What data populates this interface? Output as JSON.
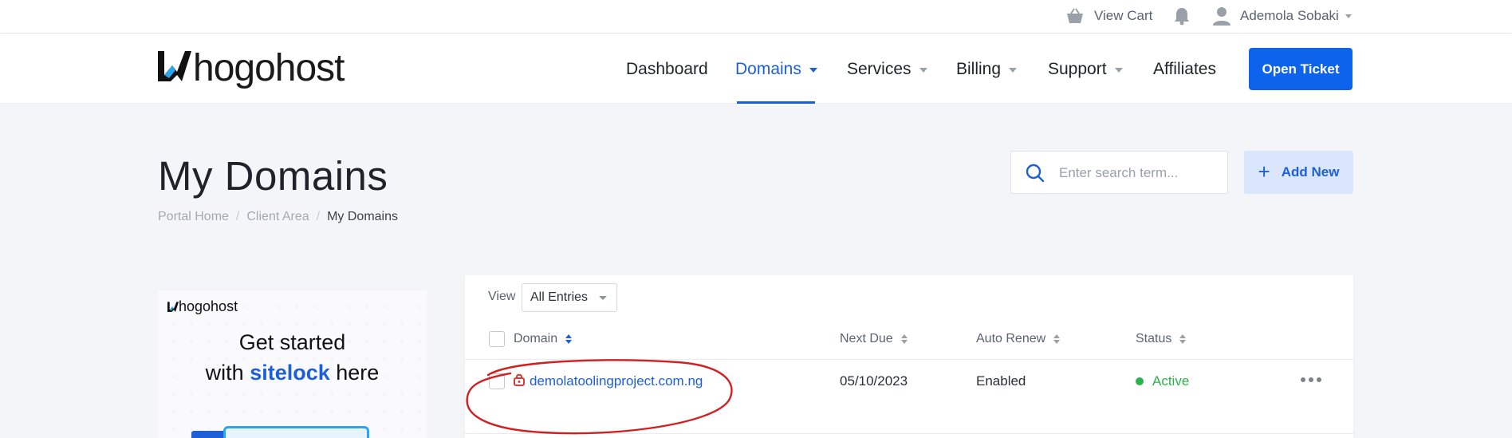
{
  "topbar": {
    "cart_label": "View Cart",
    "user_name": "Ademola Sobaki"
  },
  "nav": {
    "brand": "hogohost",
    "items": [
      {
        "label": "Dashboard"
      },
      {
        "label": "Domains"
      },
      {
        "label": "Services"
      },
      {
        "label": "Billing"
      },
      {
        "label": "Support"
      },
      {
        "label": "Affiliates"
      }
    ],
    "active_item": "Domains",
    "cta_label": "Open Ticket"
  },
  "page": {
    "title": "My Domains",
    "breadcrumb": [
      "Portal Home",
      "Client Area",
      "My Domains"
    ],
    "search_placeholder": "Enter search term...",
    "add_label": "Add New"
  },
  "banner": {
    "brand": "hogohost",
    "line1": "Get started",
    "line2_pre": "with ",
    "line2_highlight": "sitelock",
    "line2_post": " here"
  },
  "table": {
    "view_label": "View",
    "view_value": "All Entries",
    "columns": [
      "Domain",
      "Next Due",
      "Auto Renew",
      "Status"
    ],
    "rows": [
      {
        "domain": "demolatoolingproject.com.ng",
        "next_due": "05/10/2023",
        "auto_renew": "Enabled",
        "status": "Active"
      }
    ]
  },
  "colors": {
    "accent": "#1e5fd8",
    "button_primary": "#0d63ec",
    "status_active": "#2bb24c",
    "annotation": "#d21f1f",
    "lock_icon": "#d93a3a"
  }
}
